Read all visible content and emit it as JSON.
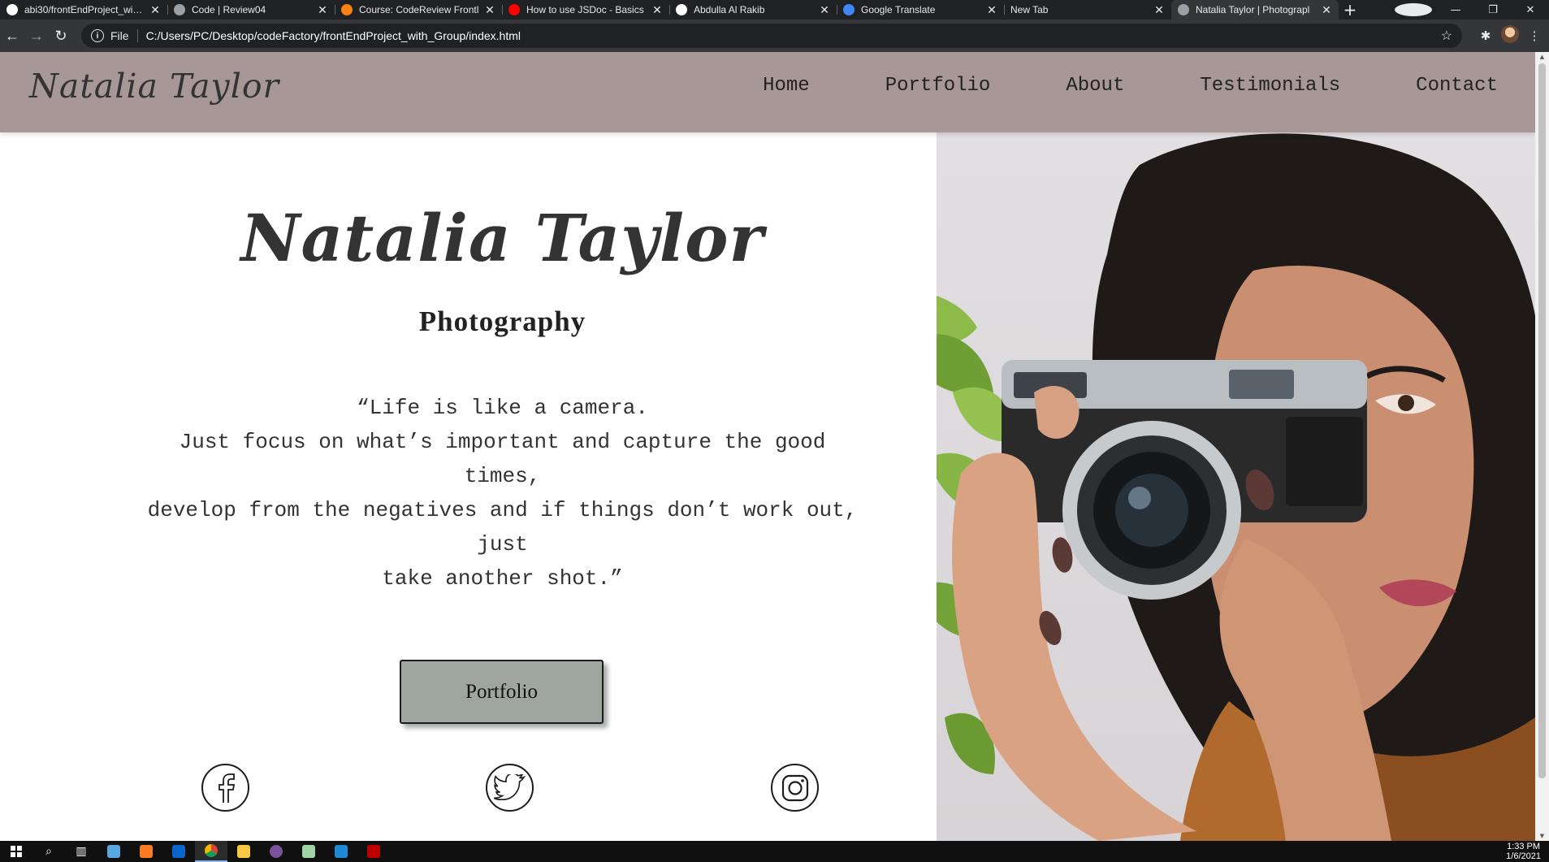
{
  "browser": {
    "tabs": [
      {
        "title": "abi30/frontEndProject_with_",
        "icon": "github-icon",
        "color": "#ffffff",
        "active": false
      },
      {
        "title": "Code | Review04",
        "icon": "globe-icon",
        "color": "#9aa0a6",
        "active": false
      },
      {
        "title": "Course: CodeReview Frontl",
        "icon": "moodle-icon",
        "color": "#f98012",
        "active": false
      },
      {
        "title": "How to use JSDoc - Basics",
        "icon": "youtube-icon",
        "color": "#ff0000",
        "active": false
      },
      {
        "title": "Abdulla Al Rakib",
        "icon": "profile-site-icon",
        "color": "#ffffff",
        "active": false
      },
      {
        "title": "Google Translate",
        "icon": "google-translate-icon",
        "color": "#4285f4",
        "active": false
      },
      {
        "title": "New Tab",
        "icon": "",
        "color": "",
        "active": false
      },
      {
        "title": "Natalia Taylor | Photograpl",
        "icon": "globe-icon",
        "color": "#9aa0a6",
        "active": true
      }
    ],
    "close_glyph": "✕",
    "new_tab_glyph": "+",
    "omnibox": {
      "scheme": "File",
      "url": "C:/Users/PC/Desktop/codeFactory/frontEndProject_with_Group/index.html"
    }
  },
  "site": {
    "brand": "Natalia Taylor",
    "nav": [
      "Home",
      "Portfolio",
      "About",
      "Testimonials",
      "Contact"
    ],
    "hero": {
      "name": "Natalia Taylor",
      "subtitle": "Photography",
      "quote_lines": [
        "“Life is like a camera.",
        "Just focus on what’s important and capture the good times,",
        "develop from the negatives and if things don’t work out, just",
        "take another shot.”"
      ],
      "cta_label": "Portfolio",
      "social": [
        {
          "name": "facebook-icon"
        },
        {
          "name": "twitter-icon"
        },
        {
          "name": "instagram-icon"
        }
      ]
    },
    "colors": {
      "nav_bg": "#a89797",
      "cta_bg": "#9ea69f",
      "text": "#333333"
    }
  },
  "taskbar": {
    "apps": [
      "windows-start-icon",
      "search-icon",
      "task-view-icon",
      "xampp-icon",
      "outlook-icon",
      "chrome-icon",
      "file-explorer-icon",
      "viber-icon",
      "notepad-plus-icon",
      "vscode-icon",
      "filezilla-icon"
    ],
    "time": "1:33 PM",
    "date": "1/6/2021"
  }
}
